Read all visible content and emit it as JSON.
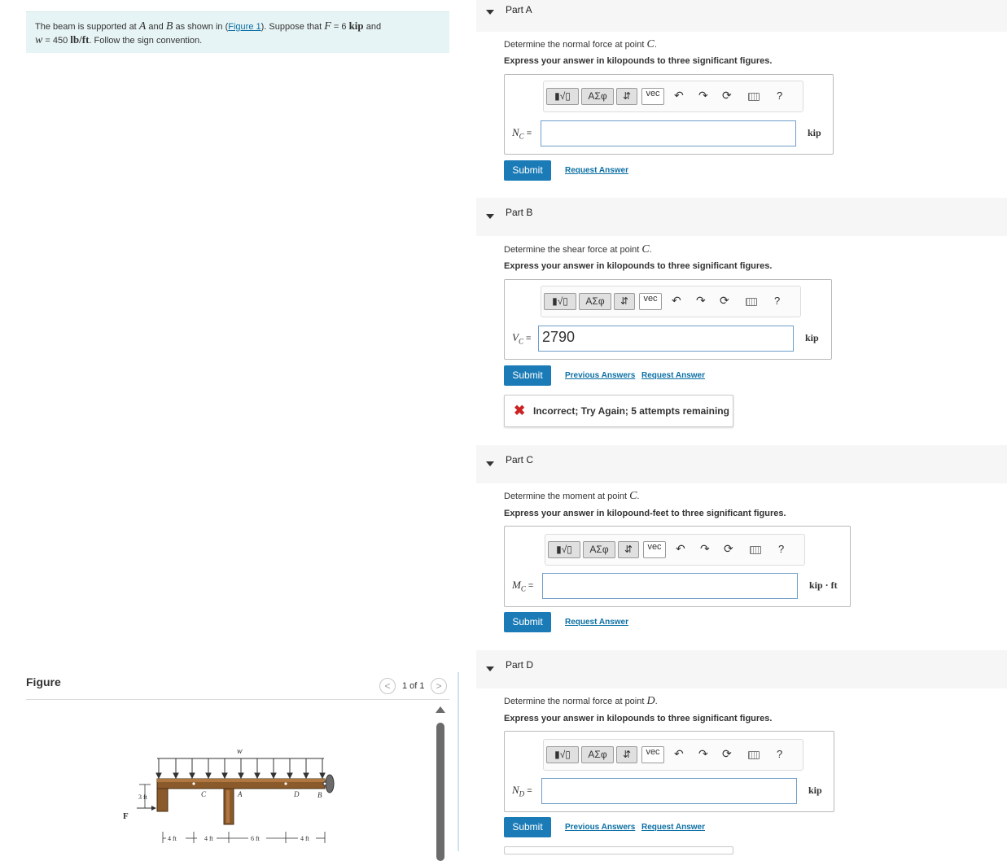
{
  "problem": {
    "t1": "The beam is supported at ",
    "A": "A",
    "t2": " and ",
    "B": "B",
    "t3": " as shown in (",
    "figure_link": "Figure 1",
    "t4": "). Suppose that ",
    "F_eq": "F",
    "F_val": " = 6 ",
    "F_unit": "kip",
    "t5": " and",
    "w_sym": "w",
    "w_val": " = 450 ",
    "w_unit": "lb/ft",
    "t6": ". Follow the sign convention."
  },
  "figure": {
    "title": "Figure",
    "pager": "1 of 1",
    "prev_icon": "chevron-left-icon",
    "next_icon": "chevron-right-icon",
    "labels": {
      "w": "w",
      "F": "F",
      "h": "3 ft",
      "A": "A",
      "B": "B",
      "C": "C",
      "D": "D",
      "d1": "4 ft",
      "d2": "4 ft",
      "d3": "6 ft",
      "d4": "4 ft"
    }
  },
  "toolbar": {
    "templates": "template-icon",
    "greek": "ΑΣφ",
    "arrows": "⇵",
    "vec": "vec",
    "undo": "undo-icon",
    "redo": "redo-icon",
    "reset": "reset-icon",
    "keyboard": "keyboard-icon",
    "help": "?"
  },
  "parts": [
    {
      "title": "Part A",
      "question_pre": "Determine the normal force at point ",
      "point": "C",
      "question_post": ".",
      "instruction": "Express your answer in kilopounds to three significant figures.",
      "var": "N",
      "sub": "C",
      "eq": " =",
      "value": "",
      "unit": "kip",
      "submit": "Submit",
      "link1": "Request Answer"
    },
    {
      "title": "Part B",
      "question_pre": "Determine the shear force at point ",
      "point": "C",
      "question_post": ".",
      "instruction": "Express your answer in kilopounds to three significant figures.",
      "var": "V",
      "sub": "C",
      "eq": " =",
      "value": "2790",
      "unit": "kip",
      "submit": "Submit",
      "link1": "Previous Answers",
      "link2": "Request Answer",
      "feedback": "Incorrect; Try Again; 5 attempts remaining"
    },
    {
      "title": "Part C",
      "question_pre": "Determine the moment at point ",
      "point": "C",
      "question_post": ".",
      "instruction": "Express your answer in kilopound-feet to three significant figures.",
      "var": "M",
      "sub": "C",
      "eq": " =",
      "value": "",
      "unit": "kip · ft",
      "submit": "Submit",
      "link1": "Request Answer"
    },
    {
      "title": "Part D",
      "question_pre": "Determine the normal force at point ",
      "point": "D",
      "question_post": ".",
      "instruction": "Express your answer in kilopounds to three significant figures.",
      "var": "N",
      "sub": "D",
      "eq": " =",
      "value": "",
      "unit": "kip",
      "submit": "Submit",
      "link1": "Previous Answers",
      "link2": "Request Answer"
    }
  ],
  "colors": {
    "problem_bg": "#e7f4f5",
    "submit_bg": "#1b7bb7",
    "link": "#0b6fa4",
    "error": "#cc2222"
  }
}
